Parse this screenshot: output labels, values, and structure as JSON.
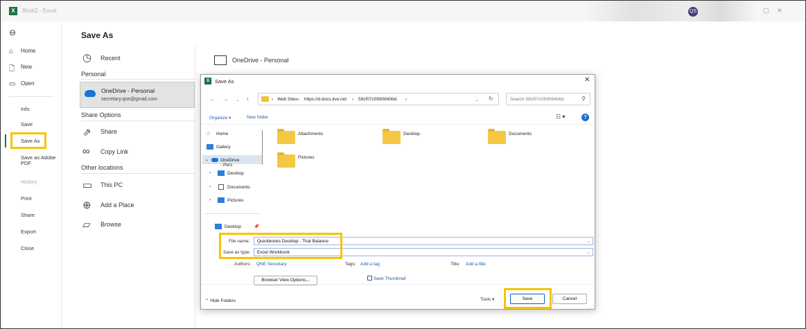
{
  "window": {
    "title": "Book2 - Excel",
    "user_initials": "QS"
  },
  "nav": {
    "back_icon": "back-arrow-icon",
    "items": [
      {
        "label": "Home",
        "icon": "home-icon"
      },
      {
        "label": "New",
        "icon": "new-file-icon"
      },
      {
        "label": "Open",
        "icon": "open-folder-icon"
      }
    ],
    "info": "Info",
    "save": "Save",
    "save_as": "Save As",
    "save_as_pdf": "Save as Adobe PDF",
    "history": "History",
    "print": "Print",
    "share": "Share",
    "export": "Export",
    "close": "Close"
  },
  "backstage": {
    "title": "Save As",
    "recent": "Recent",
    "personal": "Personal",
    "onedrive_name": "OneDrive - Personal",
    "onedrive_email": "secretary.qne@gmail.com",
    "share_options": "Share Options",
    "share": "Share",
    "copy_link": "Copy Link",
    "other_locations": "Other locations",
    "this_pc": "This PC",
    "add_place": "Add a Place",
    "browse": "Browse",
    "right_onedrive": "OneDrive - Personal"
  },
  "dialog": {
    "title": "Save As",
    "address": [
      "Web Sites",
      "https://d.docs.live.net",
      "59cf07c0590840bd"
    ],
    "search_placeholder": "Search 59cf07c0590840bd",
    "organize": "Organize ▾",
    "new_folder": "New folder",
    "tree": {
      "home": "Home",
      "gallery": "Gallery",
      "onedrive": "OneDrive - Pers",
      "desktop": "Desktop",
      "documents": "Documents",
      "pictures": "Pictures",
      "quick_desktop": "Desktop"
    },
    "folders": [
      "Attachments",
      "Desktop",
      "Documents",
      "Pictures"
    ],
    "file_name_label": "File name:",
    "file_name_value": "Quickbooks Desktop - Trial Balance",
    "save_type_label": "Save as type:",
    "save_type_value": "Excel Workbook",
    "authors_label": "Authors:",
    "authors_value": "QNE Secretary",
    "tags_label": "Tags:",
    "tags_value": "Add a tag",
    "title_label": "Title:",
    "title_value": "Add a title",
    "browser_view": "Browser View Options...",
    "save_thumbnail": "Save Thumbnail",
    "hide_folders": "Hide Folders",
    "tools": "Tools",
    "save": "Save",
    "cancel": "Cancel"
  },
  "colors": {
    "highlight": "#f7c300",
    "excel_green": "#1e7145",
    "link": "#1a5ea8"
  }
}
